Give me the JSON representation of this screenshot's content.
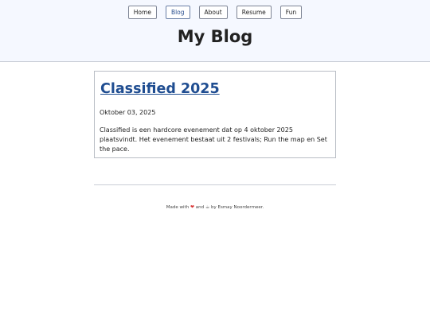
{
  "nav": {
    "items": [
      {
        "label": "Home",
        "active": false
      },
      {
        "label": "Blog",
        "active": true
      },
      {
        "label": "About",
        "active": false
      },
      {
        "label": "Resume",
        "active": false
      },
      {
        "label": "Fun",
        "active": false
      }
    ]
  },
  "header": {
    "title": "My Blog"
  },
  "post": {
    "title": "Classified 2025",
    "date": "Oktober 03, 2025",
    "excerpt": "Classified is een hardcore evenement dat op 4 oktober 2025 plaatsvindt. Het evenement bestaat uit 2 festivals; Run the map en Set the pace."
  },
  "footer": {
    "made_with": "Made with",
    "heart": "❤",
    "and": "and",
    "cup": "☕",
    "by": "by Esmay Noordermeer."
  },
  "colors": {
    "header_bg": "#f5f8ff",
    "link": "#1f4d91",
    "heart": "#d93636"
  }
}
